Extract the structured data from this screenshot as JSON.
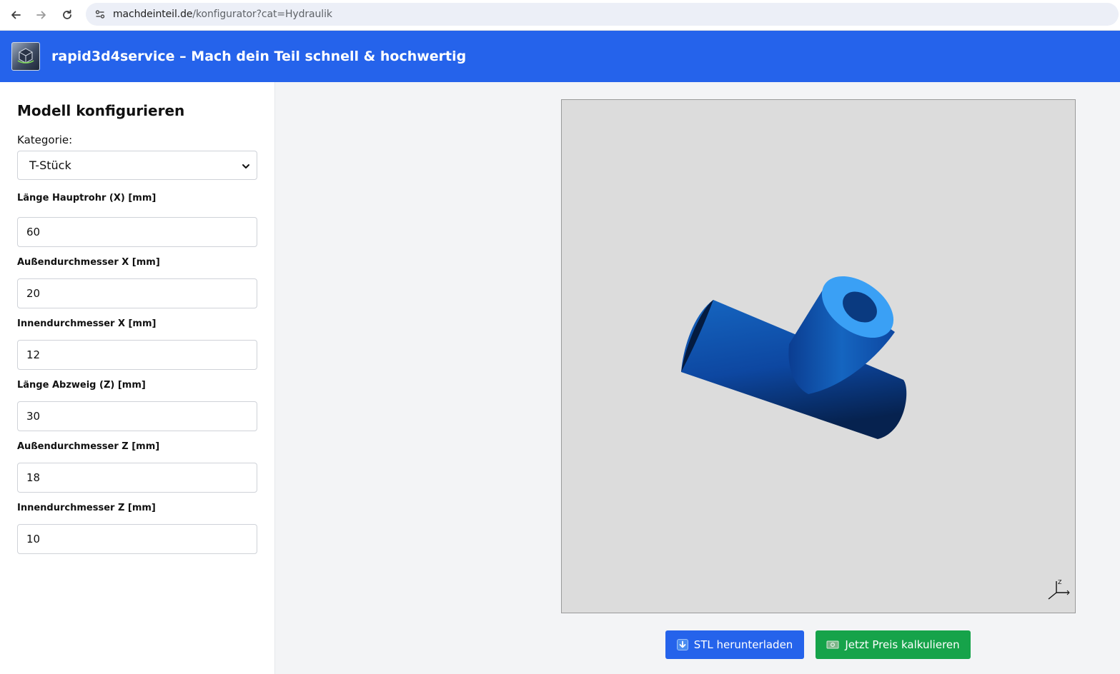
{
  "browser": {
    "url_host": "machdeinteil.de",
    "url_path": "/konfigurator?cat=Hydraulik",
    "icons": [
      "back-arrow-icon",
      "forward-arrow-icon",
      "reload-icon",
      "site-settings-icon"
    ]
  },
  "header": {
    "logo_icon": "rapid3d-logo",
    "title": "rapid3d4service – Mach dein Teil schnell & hochwertig",
    "bg_color": "#2563eb"
  },
  "sidebar": {
    "title": "Modell konfigurieren",
    "category_label": "Kategorie:",
    "category_value": "T-Stück",
    "fields": [
      {
        "label": "Länge Hauptrohr (X) [mm]",
        "value": "60"
      },
      {
        "label": "Außendurchmesser X [mm]",
        "value": "20"
      },
      {
        "label": "Innendurchmesser X [mm]",
        "value": "12"
      },
      {
        "label": "Länge Abzweig (Z) [mm]",
        "value": "30"
      },
      {
        "label": "Außendurchmesser Z [mm]",
        "value": "18"
      },
      {
        "label": "Innendurchmesser Z [mm]",
        "value": "10"
      }
    ]
  },
  "viewer": {
    "background": "#dcdcdc",
    "model_color": "#1e88e5",
    "axis_label": "Z"
  },
  "actions": {
    "stl_icon": "download-arrow-icon",
    "stl_label": "STL herunterladen",
    "stl_color": "#2563eb",
    "price_icon": "money-icon",
    "price_label": "Jetzt Preis kalkulieren",
    "price_color": "#16a34a"
  }
}
